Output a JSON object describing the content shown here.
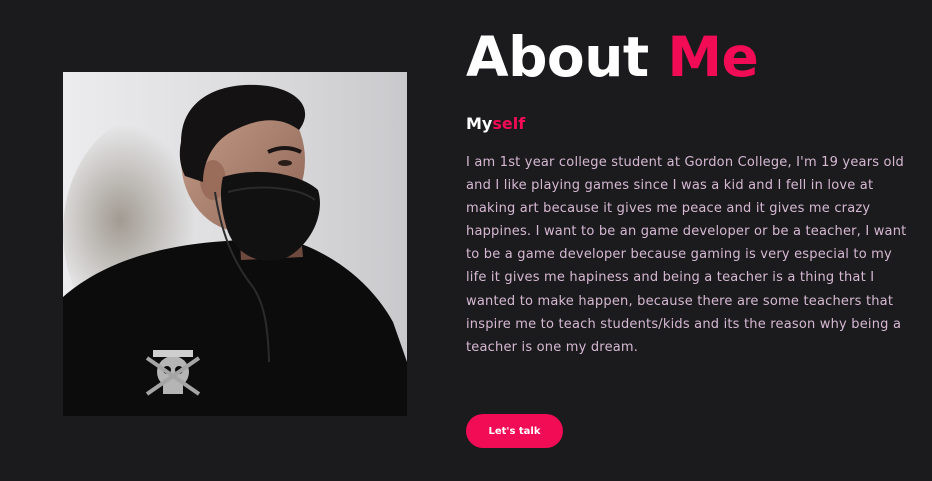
{
  "about": {
    "title_main": "About",
    "title_accent": "Me",
    "subtitle_main": "My",
    "subtitle_accent": "self",
    "bio": "I am 1st year college student at Gordon College, I'm 19 years old and I like playing games since I was a kid and I fell in love at making art because it gives me peace and it gives me crazy happines. I want to be an game developer or be a teacher, I want to be a game developer because gaming is very especial to my life it gives me hapiness and being a teacher is a thing that I wanted to make happen, because there are some teachers that inspire me to teach students/kids and its the reason why being a teacher is one my dream.",
    "cta_label": "Let's talk"
  },
  "colors": {
    "background": "#1b1b1d",
    "accent": "#f20b55",
    "heading": "#ffffff",
    "body_text": "#d6b8d3"
  },
  "photo": {
    "alt": "person-in-black-mask-portrait"
  }
}
